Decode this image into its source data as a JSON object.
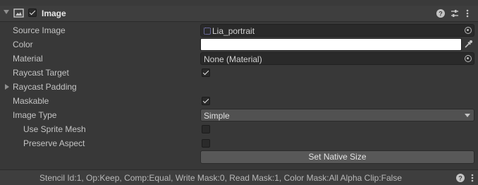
{
  "component": {
    "title": "Image",
    "enabled": true
  },
  "properties": {
    "source_image": {
      "label": "Source Image",
      "value": "Lia_portrait"
    },
    "color": {
      "label": "Color",
      "value": "#ffffff"
    },
    "material": {
      "label": "Material",
      "value": "None (Material)"
    },
    "raycast_target": {
      "label": "Raycast Target",
      "checked": true
    },
    "raycast_padding": {
      "label": "Raycast Padding"
    },
    "maskable": {
      "label": "Maskable",
      "checked": true
    },
    "image_type": {
      "label": "Image Type",
      "value": "Simple"
    },
    "use_sprite_mesh": {
      "label": "Use Sprite Mesh",
      "checked": false
    },
    "preserve_aspect": {
      "label": "Preserve Aspect",
      "checked": false
    }
  },
  "actions": {
    "set_native_size": "Set Native Size"
  },
  "footer": {
    "info": "Stencil Id:1, Op:Keep, Comp:Equal, Write Mask:0, Read Mask:1, Color Mask:All Alpha Clip:False"
  },
  "icons": [
    "foldout-arrow-icon",
    "image-component-icon",
    "help-icon",
    "presets-icon",
    "more-menu-icon",
    "object-picker-icon",
    "eyedropper-icon",
    "sprite-icon",
    "dropdown-caret-icon"
  ]
}
